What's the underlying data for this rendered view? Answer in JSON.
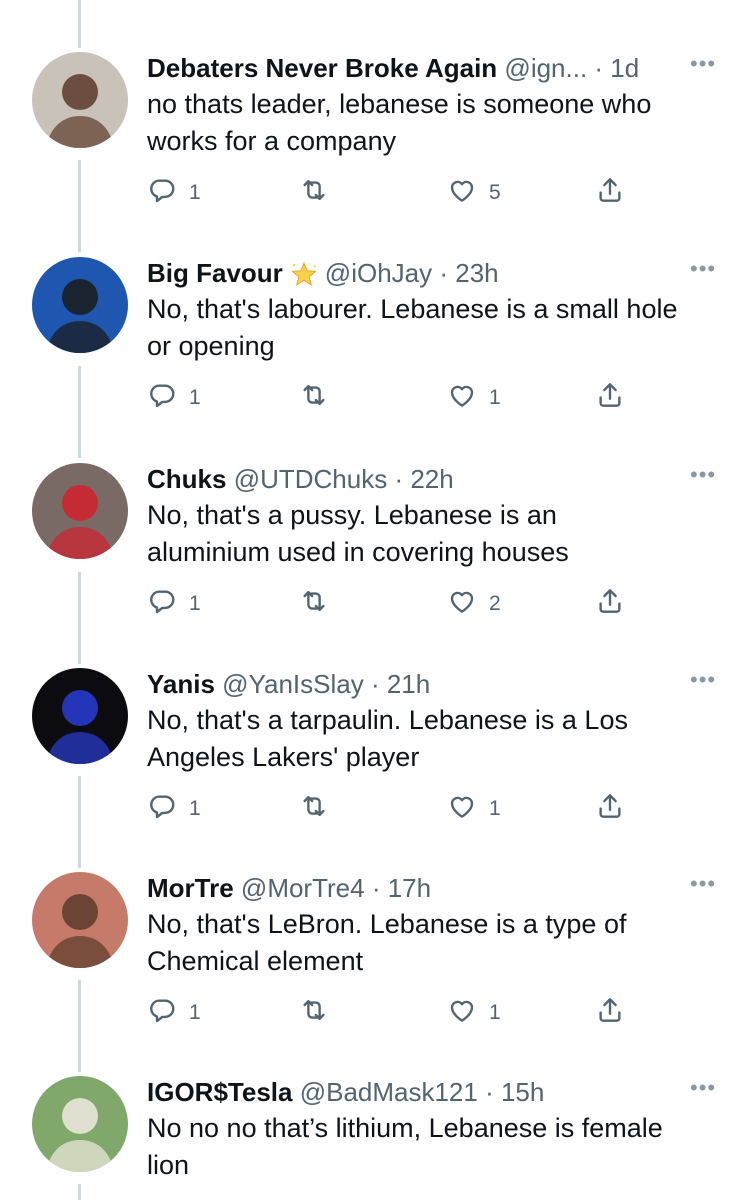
{
  "tweets": [
    {
      "name": "Debaters Never Broke Again",
      "handle": "@ign...",
      "time": "· 1d",
      "text": "no thats leader, lebanese is someone who\nworks for a company",
      "replies": "1",
      "retweets": "",
      "likes": "5",
      "avatar_colors": [
        "#c9c2b9",
        "#5b3a29"
      ]
    },
    {
      "name": "Big Favour",
      "badge": "star-emoji",
      "handle": "@iOhJay",
      "time": "· 23h",
      "text": "No, that's labourer. Lebanese is a small hole\nor opening",
      "replies": "1",
      "retweets": "",
      "likes": "1",
      "avatar_colors": [
        "#1e56b0",
        "#1a1a1a"
      ]
    },
    {
      "name": "Chuks",
      "handle": "@UTDChuks",
      "time": "· 22h",
      "text": "No, that's a pussy. Lebanese is an\naluminium used in covering houses",
      "replies": "1",
      "retweets": "",
      "likes": "2",
      "avatar_colors": [
        "#7a6a66",
        "#d1202b"
      ]
    },
    {
      "name": "Yanis",
      "handle": "@YanIsSlay",
      "time": "· 21h",
      "text": "No, that's a tarpaulin. Lebanese is a  Los\nAngeles Lakers' player",
      "replies": "1",
      "retweets": "",
      "likes": "1",
      "avatar_colors": [
        "#0c0c10",
        "#2a3dd6"
      ]
    },
    {
      "name": "MorTre",
      "handle": "@MorTre4",
      "time": "· 17h",
      "text": "No, that's LeBron. Lebanese is a type of\nChemical element",
      "replies": "1",
      "retweets": "",
      "likes": "1",
      "avatar_colors": [
        "#c57a6a",
        "#5a3b2a"
      ]
    },
    {
      "name": "IGOR$Tesla",
      "handle": "@BadMask121",
      "time": "· 15h",
      "text": "No no no that’s lithium, Lebanese is female\nlion",
      "replies": "",
      "retweets": "",
      "likes": "",
      "avatar_colors": [
        "#7fa86a",
        "#efe9df"
      ]
    }
  ],
  "more_glyph": "•••",
  "colors": {
    "text": "#0f1419",
    "secondary": "#536471",
    "thread_line": "#cfd9de"
  }
}
